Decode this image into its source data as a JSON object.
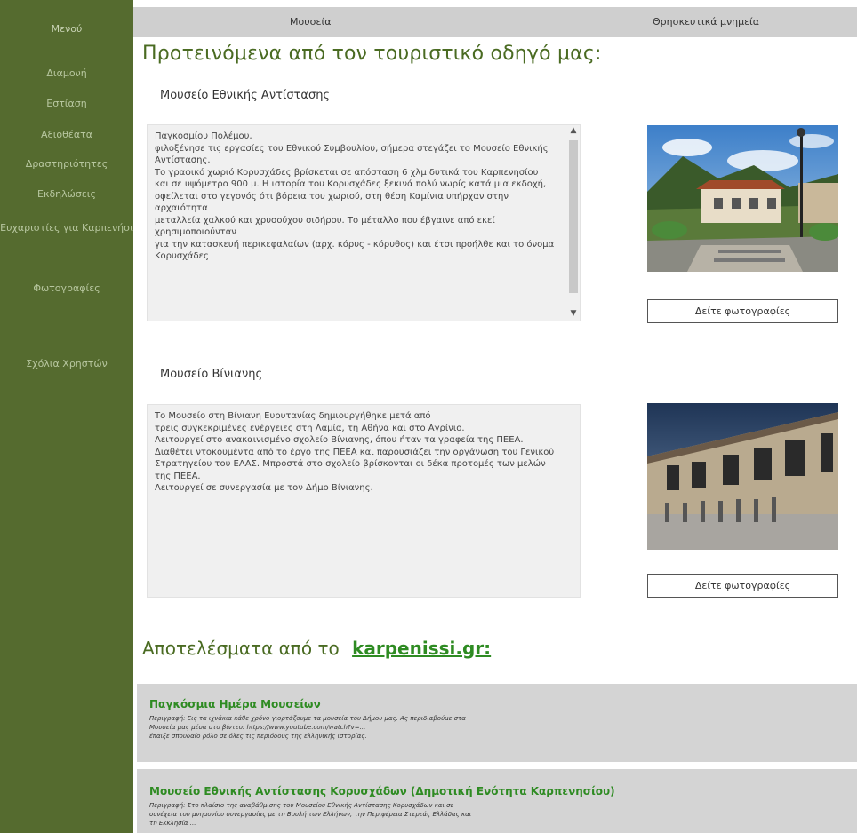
{
  "sidebar": {
    "title": "Μενού",
    "items": [
      {
        "label": "Διαμονή"
      },
      {
        "label": "Εστίαση"
      },
      {
        "label": "Αξιοθέατα"
      },
      {
        "label": "Δραστηριότητες"
      },
      {
        "label": "Εκδηλώσεις"
      },
      {
        "label": "Ευχαριστίες για Καρπενήσι"
      },
      {
        "label": "Φωτογραφίες"
      },
      {
        "label": "Σχόλια Χρηστών"
      }
    ]
  },
  "topbar": {
    "tabs": [
      {
        "label": "Μουσεία"
      },
      {
        "label": "Θρησκευτικά μνημεία"
      }
    ]
  },
  "recommended": {
    "title": "Προτεινόμενα από τον τουριστικό οδηγό μας:",
    "museums": [
      {
        "name": "Μουσείο Εθνικής Αντίστασης",
        "description": "Παγκοσμίου Πολέμου,\nφιλοξένησε τις εργασίες του Εθνικού Συμβουλίου, σήμερα στεγάζει το Μουσείο Εθνικής Αντίστασης.\nΤο γραφικό χωριό Κορυσχάδες βρίσκεται σε απόσταση 6 χλμ δυτικά του Καρπενησίου\nκαι σε υψόμετρο 900 μ. Η ιστορία του Κορυσχάδες ξεκινά πολύ νωρίς κατά μια εκδοχή,\nοφείλεται στο γεγονός ότι βόρεια του χωριού, στη θέση Καμίνια υπήρχαν στην αρχαιότητα\nμεταλλεία χαλκού και χρυσούχου σιδήρου. Το μέταλλο που έβγαινε από εκεί χρησιμοποιούνταν\nγια την κατασκευή περικεφαλαίων (αρχ. κόρυς - κόρυθος) και έτσι προήλθε και το όνομα Κορυσχάδες",
        "photo_button": "Δείτε φωτογραφίες"
      },
      {
        "name": "Μουσείο Βίνιανης",
        "description": "Το Μουσείο στη Βίνιανη Ευρυτανίας δημιουργήθηκε μετά από\nτρεις συγκεκριμένες ενέργειες στη Λαμία, τη Αθήνα και στο Αγρίνιο.\nΛειτουργεί στο ανακαινισμένο σχολείο Βίνιανης, όπου ήταν τα γραφεία της ΠΕΕΑ. Διαθέτει ντοκουμέντα από το έργο της ΠΕΕΑ και παρουσιάζει την οργάνωση του Γενικού Στρατηγείου του ΕΛΑΣ. Μπροστά στο σχολείο βρίσκονται οι δέκα προτομές των μελών της ΠΕΕΑ.\nΛειτουργεί σε συνεργασία με τον Δήμο Βίνιανης.",
        "photo_button": "Δείτε φωτογραφίες"
      }
    ]
  },
  "results": {
    "title_prefix": "Αποτελέσματα από το",
    "link_text": "karpenissi.gr:",
    "items": [
      {
        "title": "Παγκόσμια Ημέρα Μουσείων",
        "description": "Περιγραφή: Εις τα ιχνάκια κάθε χρόνο γιορτάζουμε τα μουσεία του Δήμου μας. Ας περιδιαβούμε στα\nΜουσεία μας μέσα στο βίντεο: https://www.youtube.com/watch?v=...\nέπαιξε σπουδαίο ρόλο σε όλες τις περιόδους της ελληνικής ιστορίας."
      },
      {
        "title": "Μουσείο Εθνικής Αντίστασης Κορυσχάδων (Δημοτική Ενότητα Καρπενησίου)",
        "description": "Περιγραφή: Στο πλαίσιο της αναβάθμισης του Μουσείου Εθνικής Αντίστασης Κορυσχάδων και σε\nσυνέχεια του μνημονίου συνεργασίας με τη Βουλή των Ελλήνων, την Περιφέρεια Στερεάς Ελλάδας και\nτη Εκκλησία ..."
      }
    ]
  }
}
